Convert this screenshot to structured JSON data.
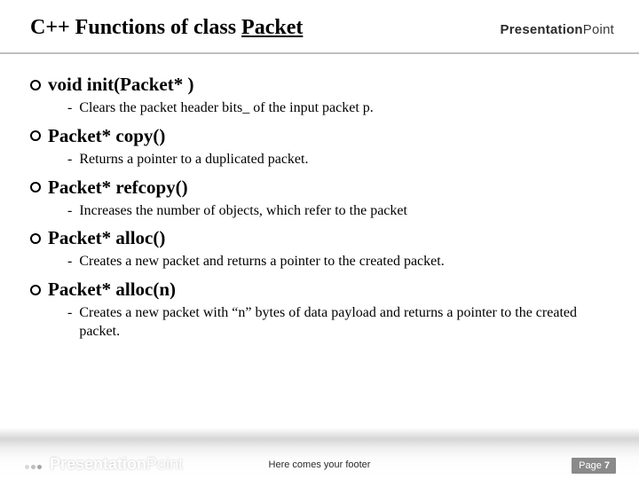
{
  "header": {
    "title_prefix": "C++ Functions of class ",
    "title_underlined": "Packet",
    "brand_prefix": "Presentation",
    "brand_suffix": "Point"
  },
  "functions": [
    {
      "signature": "void init(Packet* )",
      "description": "Clears the packet header bits_ of the input packet p."
    },
    {
      "signature": "Packet* copy()",
      "description": "Returns a pointer to a duplicated packet."
    },
    {
      "signature": "Packet* refcopy()",
      "description": "Increases the number of objects, which refer to the packet"
    },
    {
      "signature": "Packet* alloc()",
      "description": "Creates a new packet and returns a pointer to the created packet."
    },
    {
      "signature": "Packet* alloc(n)",
      "description": "Creates a new packet with “n” bytes of data payload and returns a pointer to the created packet."
    }
  ],
  "footer": {
    "brand_prefix": "Presentation",
    "brand_suffix": "Point",
    "center_text": "Here comes your footer",
    "page_label": "Page ",
    "page_number": "7"
  }
}
